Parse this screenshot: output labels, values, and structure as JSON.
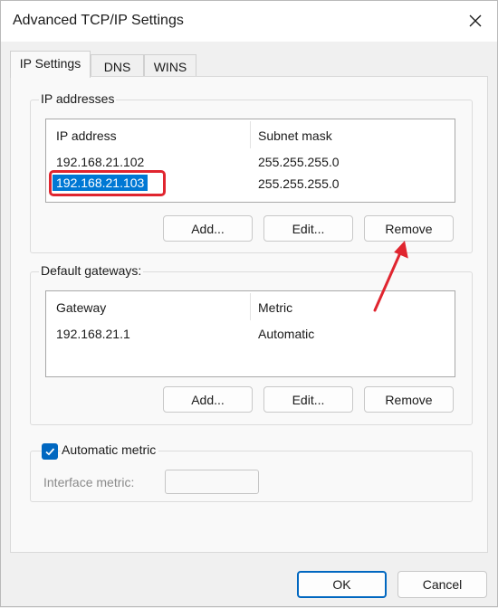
{
  "window": {
    "title": "Advanced TCP/IP Settings",
    "close_icon": "close-icon"
  },
  "tabs": [
    {
      "label": "IP Settings",
      "active": true
    },
    {
      "label": "DNS",
      "active": false
    },
    {
      "label": "WINS",
      "active": false
    }
  ],
  "ip_addresses": {
    "group_label": "IP addresses",
    "columns": [
      "IP address",
      "Subnet mask"
    ],
    "rows": [
      {
        "ip": "192.168.21.102",
        "mask": "255.255.255.0",
        "selected": false
      },
      {
        "ip": "192.168.21.103",
        "mask": "255.255.255.0",
        "selected": true
      }
    ],
    "buttons": {
      "add": "Add...",
      "edit": "Edit...",
      "remove": "Remove"
    }
  },
  "default_gateways": {
    "group_label": "Default gateways:",
    "columns": [
      "Gateway",
      "Metric"
    ],
    "rows": [
      {
        "gateway": "192.168.21.1",
        "metric": "Automatic"
      }
    ],
    "buttons": {
      "add": "Add...",
      "edit": "Edit...",
      "remove": "Remove"
    }
  },
  "metric": {
    "automatic_label": "Automatic metric",
    "automatic_checked": true,
    "interface_label": "Interface metric:",
    "interface_value": ""
  },
  "footer": {
    "ok": "OK",
    "cancel": "Cancel"
  },
  "colors": {
    "accent": "#0067c0",
    "selection": "#0078d4",
    "annotation": "#e0252f"
  }
}
